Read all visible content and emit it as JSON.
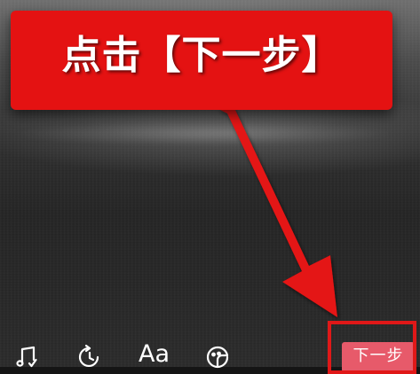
{
  "annotation": {
    "instruction_text": "点击【下一步】",
    "color": "#e41212"
  },
  "toolbar": {
    "items": [
      {
        "icon": "music-note-icon"
      },
      {
        "icon": "timer-refresh-icon"
      },
      {
        "icon": "text-style-icon",
        "label": "Aa"
      },
      {
        "icon": "sticker-icon"
      }
    ],
    "next_button_label": "下一步",
    "next_button_color": "#e75a6a"
  }
}
